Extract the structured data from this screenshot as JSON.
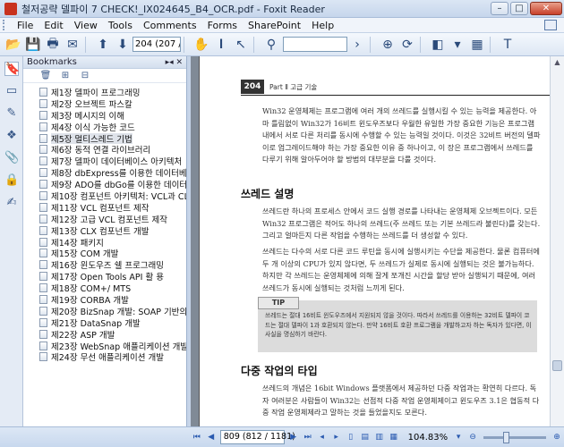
{
  "window": {
    "title": "철저공략 델파이 7 CHECK!_IX024645_B4_OCR.pdf - Foxit Reader"
  },
  "menu": [
    "File",
    "Edit",
    "View",
    "Tools",
    "Comments",
    "Forms",
    "SharePoint",
    "Help"
  ],
  "toolbar": {
    "page_field": "204 (207 / 118"
  },
  "sidebar": {
    "title": "Bookmarks",
    "items": [
      "제1장 델파이 프로그래밍",
      "제2장 오브젝트 파스칼",
      "제3장 메시지의 이해",
      "제4장 이식 가능한 코드",
      "제5장 멀티스레드 기법",
      "제6장 동적 연결 라이브러리",
      "제7장 델파이 데이터베이스 아키텍처",
      "제8장 dbExpress를 이용한 데이터베이스 개",
      "제9장 ADO를 dbGo를 이용한 데이터베이스",
      "제10장 컴포넌트 아키텍처: VCL과 CLX",
      "제11장 VCL 컴포넌트 제작",
      "제12장 고급 VCL 컴포넌트 제작",
      "제13장 CLX 컴포넌트 개발",
      "제14장 패키지",
      "제15장 COM 개발",
      "제16장 윈도우즈 쉘 프로그래밍",
      "제17장 Open Tools API 활 용",
      "제18장 COM+/ MTS",
      "제19장 CORBA 개발",
      "제20장 BizSnap 개발: SOAP 기반의 웹 서비",
      "제21장 DataSnap 개발",
      "제22장 ASP 개발",
      "제23장 WebSnap 애플리케이션 개발",
      "제24장 무선 애플리케이션 개발"
    ],
    "selected_index": 4
  },
  "document": {
    "page_number": "204",
    "part_label": "Part Ⅱ 고급 기술",
    "para1": "Win32 운영체제는 프로그램에 여러 개의 쓰레드를 실행시킬 수 있는 능력을 제공한다. 아마 틀림없이 Win32가 16비트 윈도우즈보다 우월한 유일한 가장 중요한 기능은 프로그램 내에서 서로 다른 처리를 동시에 수행할 수 있는 능력일 것이다. 이것은 32비트 버전의 델파이로 업그레이드해야 하는 가장 중요한 이유 중 하나이고, 이 장은 프로그램에서 쓰레드를 다루기 위해 알아두어야 할 방법의 대부분을 다룰 것이다.",
    "heading1": "쓰레드 설명",
    "para2": "쓰레드란 하나의 프로세스 안에서 코드 실행 경로를 나타내는 운영체제 오브젝트이다. 모든 Win32 프로그램은 적어도 하나의 쓰레드(주 쓰레드 또는 기본 쓰레드라 불린다)를 갖는다. 그리고 얼마든지 다른 작업을 수행하는 쓰레드를 더 생성할 수 있다.",
    "para3": "쓰레드는 다수의 서로 다른 코드 루틴을 동시에 실행시키는 수단을 제공한다. 물론 컴퓨터에 두 개 이상의 CPU가 있지 않다면, 두 쓰레드가 실제로 동시에 실행되는 것은 불가능하다. 하지만 각 쓰레드는 운영체제에 의해 잘게 쪼개진 시간을 할당 받아 실행되기 때문에, 여러 쓰레드가 동시에 실행되는 것처럼 느끼게 된다.",
    "tip_label": "TIP",
    "tip_text": "쓰레드는 절대 16비트 윈도우즈에서 지원되지 않을 것이다. 따라서 쓰레드를 이용하는 32비트 델파이 코드는 절대 델파이 1과 호환되지 않는다. 만약 16비트 호환 프로그램을 개발하고자 하는 독자가 있다면, 이 사실을 명심하기 바란다.",
    "heading2": "다중 작업의 타입",
    "para4": "쓰레드의 개념은 16bit Windows 플랫폼에서 제공하던 다중 작업과는 확연히 다르다. 독자 여러분은 사람들이 Win32는 선점적 다중 작업 운영체제이고 윈도우즈 3.1은 협동적 다중 작업 운영체제라고 말하는 것을 들었을지도 모른다."
  },
  "statusbar": {
    "page_field": "809 (812 / 1181)",
    "zoom": "104.83%"
  }
}
